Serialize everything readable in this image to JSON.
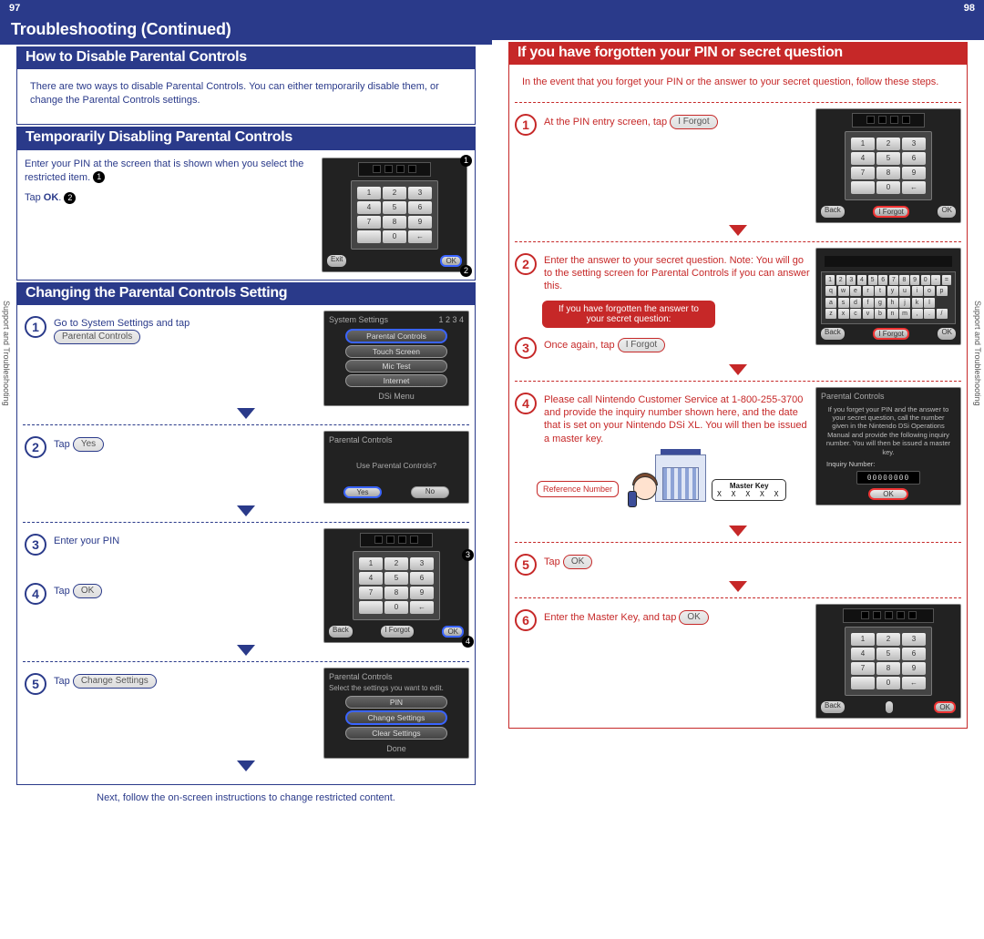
{
  "pages": {
    "left": "97",
    "right": "98"
  },
  "chapter": "Troubleshooting (Continued)",
  "sidebar": "Support and Troubleshooting",
  "left_col": {
    "how_to_title": "How to Disable Parental Controls",
    "how_to_body": "There are two ways to disable Parental Controls. You can either temporarily disable them, or change the Parental Controls settings.",
    "temp_title": "Temporarily Disabling Parental Controls",
    "temp_step1": "Enter your PIN at the screen that is shown when you select the restricted item.",
    "temp_step2_prefix": "Tap ",
    "temp_step2_bold": "OK",
    "change_title": "Changing the Parental Controls Setting",
    "steps": {
      "s1": "Go to System Settings and tap",
      "s1_pill": "Parental Controls",
      "s2": "Tap",
      "s2_pill": "Yes",
      "s3": "Enter your PIN",
      "s4": "Tap",
      "s4_pill": "OK",
      "s5": "Tap",
      "s5_pill": "Change Settings"
    },
    "ds_screens": {
      "pin_exit": "Exit",
      "pin_ok": "OK",
      "sys_title": "System Settings",
      "sys_tabs": "1  2  3  4",
      "sys_items": [
        "Parental Controls",
        "Touch Screen",
        "Mic Test",
        "Internet"
      ],
      "sys_footer": "DSi Menu",
      "pc_title": "Parental Controls",
      "pc_q": "Use Parental Controls?",
      "pc_yes": "Yes",
      "pc_no": "No",
      "pin_back": "Back",
      "pin_forgot": "I Forgot",
      "pin_ok2": "OK",
      "cs_title": "Parental Controls",
      "cs_caption": "Select the settings you want to edit.",
      "cs_items": [
        "PIN",
        "Change Settings",
        "Clear Settings"
      ],
      "cs_done": "Done"
    },
    "footer": "Next, follow the on-screen instructions to change restricted content."
  },
  "right_col": {
    "title": "If you have forgotten your PIN or secret question",
    "intro": "In the event that you forget your PIN or the answer to your secret question, follow these steps.",
    "s1": "At the PIN entry screen, tap",
    "s1_pill": "I Forgot",
    "s2": "Enter the answer to your secret question. Note: You will go to the setting screen for Parental Controls if you can answer this.",
    "note_title": "If you have forgotten the answer to your secret question:",
    "s3": "Once again, tap",
    "s3_pill": "I Forgot",
    "s4": "Please call Nintendo Customer Service at 1-800-255-3700 and provide the inquiry number shown here, and the date that is set on your Nintendo DSi XL. You will then be issued a master key.",
    "ref_label": "Reference Number",
    "master_key_label": "Master Key",
    "master_key_val": "X X X X X",
    "s5": "Tap",
    "s5_pill": "OK",
    "s6": "Enter the Master Key, and tap",
    "s6_pill": "OK",
    "ds": {
      "back": "Back",
      "iforgot": "I Forgot",
      "ok": "OK",
      "pc_title": "Parental Controls",
      "pc_body1": "If you forget your PIN and the answer to your secret question,",
      "pc_body2": "call the number given in the Nintendo DSi Operations Manual and provide",
      "pc_body3": "the following inquiry number. You will then be issued a master key.",
      "inq_label": "Inquiry Number:",
      "inq_num": "00000000",
      "kb_row1": [
        "1",
        "2",
        "3",
        "4",
        "5",
        "6",
        "7",
        "8",
        "9",
        "0",
        "-",
        "="
      ],
      "kb_row2": [
        "q",
        "w",
        "e",
        "r",
        "t",
        "y",
        "u",
        "i",
        "o",
        "p"
      ],
      "kb_row3": [
        "a",
        "s",
        "d",
        "f",
        "g",
        "h",
        "j",
        "k",
        "l"
      ],
      "kb_row4": [
        "z",
        "x",
        "c",
        "v",
        "b",
        "n",
        "m",
        ",",
        ".",
        "/"
      ]
    }
  }
}
